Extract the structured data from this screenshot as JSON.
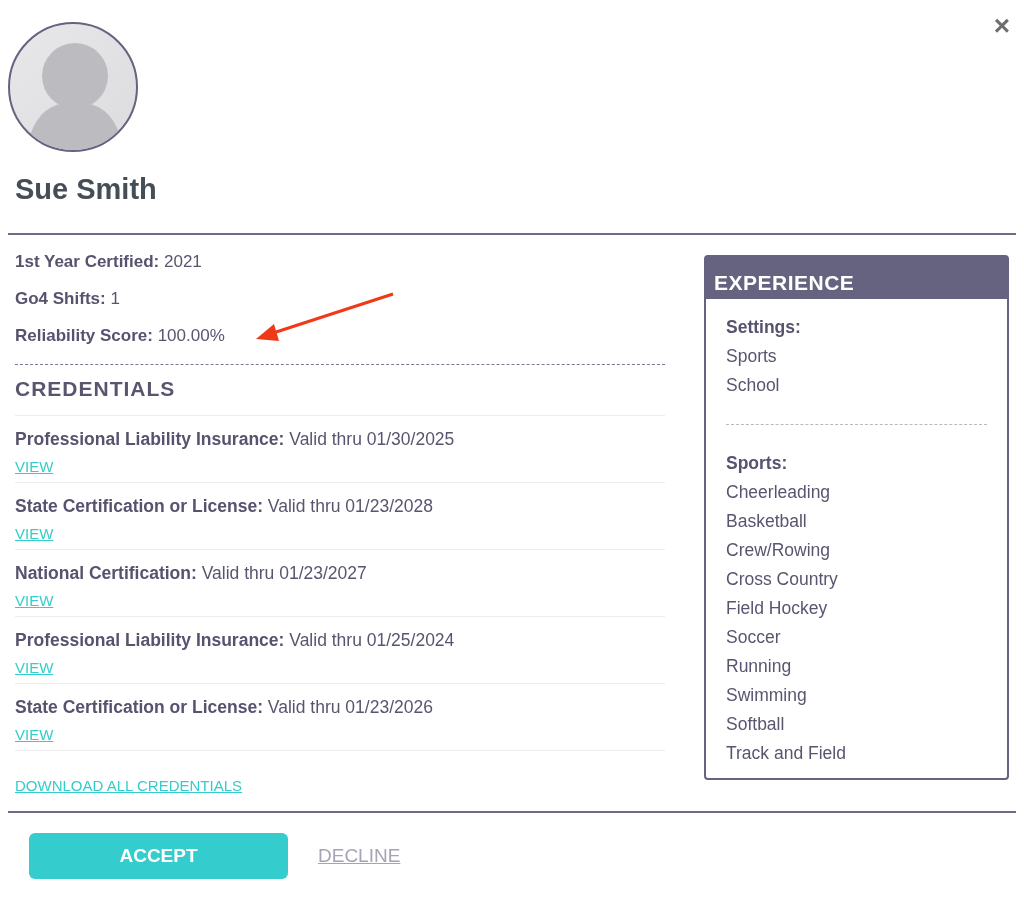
{
  "close_button": "×",
  "profile": {
    "name": "Sue Smith"
  },
  "stats": [
    {
      "label": "1st Year Certified:",
      "value": "2021"
    },
    {
      "label": "Go4 Shifts:",
      "value": "1"
    },
    {
      "label": "Reliability Score:",
      "value": "100.00%"
    }
  ],
  "credentials": {
    "heading": "CREDENTIALS",
    "items": [
      {
        "title": "Professional Liability Insurance:",
        "validity": "Valid thru 01/30/2025",
        "link": "VIEW"
      },
      {
        "title": "State Certification or License:",
        "validity": "Valid thru 01/23/2028",
        "link": "VIEW"
      },
      {
        "title": "National Certification:",
        "validity": "Valid thru 01/23/2027",
        "link": "VIEW"
      },
      {
        "title": "Professional Liability Insurance:",
        "validity": "Valid thru 01/25/2024",
        "link": "VIEW"
      },
      {
        "title": "State Certification or License:",
        "validity": "Valid thru 01/23/2026",
        "link": "VIEW"
      }
    ],
    "download_link": "DOWNLOAD ALL CREDENTIALS"
  },
  "experience": {
    "heading": "EXPERIENCE",
    "groups": [
      {
        "label": "Settings:",
        "items": [
          "Sports",
          "School"
        ]
      },
      {
        "label": "Sports:",
        "items": [
          "Cheerleading",
          "Basketball",
          "Crew/Rowing",
          "Cross Country",
          "Field Hockey",
          "Soccer",
          "Running",
          "Swimming",
          "Softball",
          "Track and Field"
        ]
      }
    ]
  },
  "buttons": [
    {
      "label": "ACCEPT",
      "kind": "primary"
    },
    {
      "label": "DECLINE",
      "kind": "link"
    }
  ]
}
